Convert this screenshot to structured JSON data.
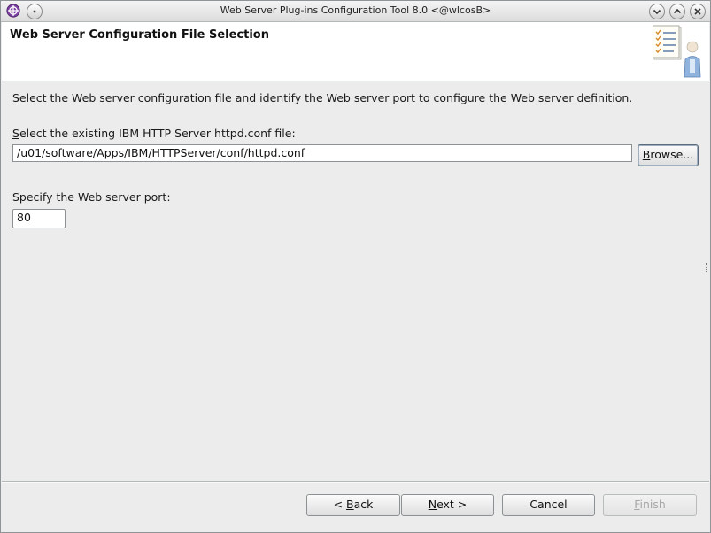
{
  "window": {
    "title": "Web Server Plug-ins Configuration Tool 8.0  <@wlcosB>"
  },
  "banner": {
    "title": "Web Server Configuration File Selection"
  },
  "content": {
    "description": "Select the Web server configuration file and identify the Web server port to configure the Web server definition.",
    "config_label_mnemonic": "S",
    "config_label_rest": "elect the existing IBM HTTP Server httpd.conf file:",
    "config_path": "/u01/software/Apps/IBM/HTTPServer/conf/httpd.conf",
    "browse_mnemonic": "B",
    "browse_rest": "rowse...",
    "port_label": "Specify the Web server port:",
    "port_value": "80"
  },
  "footer": {
    "back_prefix": "< ",
    "back_mnemonic": "B",
    "back_rest": "ack",
    "next_mnemonic": "N",
    "next_rest": "ext >",
    "cancel_label": "Cancel",
    "finish_mnemonic": "F",
    "finish_rest": "inish"
  },
  "icons": [
    "app-logo-icon",
    "window-menu-icon",
    "minimize-icon",
    "maximize-icon",
    "close-icon",
    "checklist-person-icon"
  ]
}
